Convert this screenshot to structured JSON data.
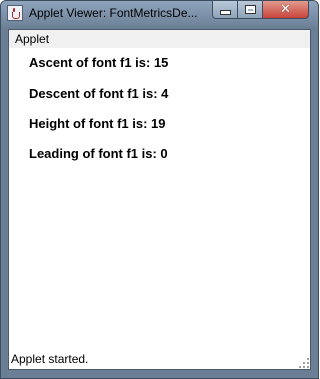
{
  "window": {
    "title": "Applet Viewer: FontMetricsDe...",
    "close_glyph": "✕"
  },
  "menu": {
    "applet": "Applet"
  },
  "metrics": [
    "Ascent of font f1 is: 15",
    "Descent of font f1 is: 4",
    "Height of font f1 is: 19",
    "Leading of font f1 is: 0"
  ],
  "status": "Applet started.",
  "icons": {
    "app": "java-cup-icon",
    "minimize": "minimize-icon",
    "maximize": "maximize-icon",
    "close": "close-icon"
  },
  "colors": {
    "titlebar": "#7b90a8",
    "close_button": "#c8433a"
  }
}
